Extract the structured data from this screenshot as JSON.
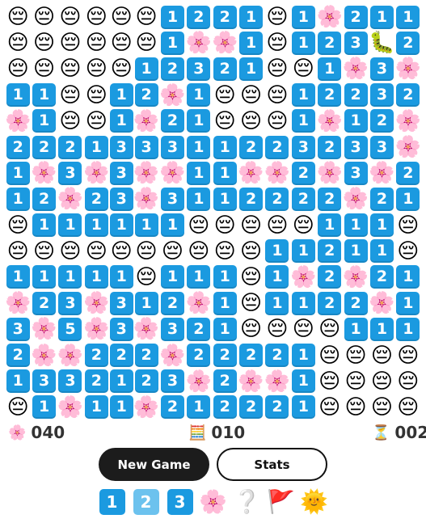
{
  "board": {
    "rows": [
      [
        "😔",
        "😔",
        "😔",
        "😔",
        "😔",
        "😔",
        "1",
        "2",
        "2",
        "1",
        "😔",
        "1",
        "🌸",
        "2",
        "1",
        "1"
      ],
      [
        "😔",
        "😔",
        "😔",
        "😔",
        "😔",
        "😔",
        "1",
        "🌸",
        "🌸",
        "1",
        "😔",
        "1",
        "2",
        "3",
        "🐛",
        "2"
      ],
      [
        "😔",
        "😔",
        "😔",
        "😔",
        "😔",
        "1",
        "2",
        "3",
        "2",
        "1",
        "😔",
        "😔",
        "1",
        "🌸",
        "3",
        "🌸"
      ],
      [
        "1",
        "1",
        "😔",
        "😔",
        "1",
        "2",
        "🌸",
        "1",
        "😔",
        "😔",
        "😔",
        "1",
        "2",
        "2",
        "3",
        "2"
      ],
      [
        "🌸",
        "1",
        "😔",
        "😔",
        "1",
        "🌸",
        "2",
        "1",
        "😔",
        "😔",
        "😔",
        "1",
        "🌸",
        "1",
        "2",
        "🌸"
      ],
      [
        "2",
        "2",
        "2",
        "1",
        "3",
        "3",
        "3",
        "1",
        "1",
        "2",
        "2",
        "3",
        "2",
        "3",
        "3",
        "🌸"
      ],
      [
        "1",
        "🌸",
        "3",
        "🌸",
        "3",
        "🌸",
        "🌸",
        "1",
        "1",
        "🌸",
        "🌸",
        "2",
        "🌸",
        "3",
        "🌸",
        "2"
      ],
      [
        "1",
        "2",
        "🌸",
        "2",
        "3",
        "🌸",
        "3",
        "1",
        "1",
        "2",
        "2",
        "2",
        "2",
        "🌸",
        "2",
        "1"
      ],
      [
        "😔",
        "1",
        "1",
        "1",
        "1",
        "1",
        "1",
        "😔",
        "😔",
        "😔",
        "😔",
        "😔",
        "1",
        "1",
        "1",
        "😔"
      ],
      [
        "😔",
        "😔",
        "😔",
        "😔",
        "😔",
        "😔",
        "😔",
        "😔",
        "😔",
        "😔",
        "1",
        "1",
        "2",
        "1",
        "1",
        "😔"
      ],
      [
        "1",
        "1",
        "1",
        "1",
        "1",
        "😔",
        "1",
        "1",
        "1",
        "😔",
        "1",
        "🌸",
        "2",
        "🌸",
        "2",
        "1"
      ],
      [
        "🌸",
        "2",
        "3",
        "🌸",
        "3",
        "1",
        "2",
        "🌸",
        "1",
        "😔",
        "1",
        "1",
        "2",
        "2",
        "🌸",
        "1"
      ],
      [
        "3",
        "🌸",
        "5",
        "🌸",
        "3",
        "🌸",
        "3",
        "2",
        "1",
        "😔",
        "😔",
        "😔",
        "😔",
        "1",
        "1",
        "1"
      ],
      [
        "2",
        "🌸",
        "🌸",
        "2",
        "2",
        "2",
        "🌸",
        "2",
        "2",
        "2",
        "2",
        "1",
        "😔",
        "😔",
        "😔",
        "😔"
      ],
      [
        "1",
        "3",
        "3",
        "2",
        "1",
        "2",
        "3",
        "🌸",
        "2",
        "🌸",
        "🌸",
        "1",
        "😔",
        "😔",
        "😔",
        "😔"
      ],
      [
        "😔",
        "1",
        "🌸",
        "1",
        "1",
        "🌸",
        "2",
        "1",
        "2",
        "2",
        "2",
        "1",
        "😔",
        "😔",
        "😔",
        "😔"
      ]
    ]
  },
  "status": {
    "flowers": {
      "icon": "🌸",
      "icon_name": "flower-icon",
      "value": "040"
    },
    "abacus": {
      "icon": "🧮",
      "icon_name": "abacus-icon",
      "value": "010"
    },
    "timer": {
      "icon": "⏳",
      "icon_name": "hourglass-icon",
      "value": "002"
    }
  },
  "controls": {
    "new_game_label": "New Game",
    "stats_label": "Stats"
  },
  "palette": [
    {
      "kind": "tile",
      "label": "1",
      "name": "tile-1-swatch"
    },
    {
      "kind": "tile-light",
      "label": "2",
      "name": "tile-2-swatch"
    },
    {
      "kind": "tile",
      "label": "3",
      "name": "tile-3-swatch"
    },
    {
      "kind": "emoji",
      "label": "🌸",
      "name": "flower-icon"
    },
    {
      "kind": "emoji",
      "label": "❔",
      "name": "question-icon"
    },
    {
      "kind": "emoji",
      "label": "🚩",
      "name": "flag-icon"
    },
    {
      "kind": "emoji",
      "label": "🌞",
      "name": "sun-face-icon"
    }
  ],
  "colors": {
    "tile": "#1b9ae0",
    "tile_light": "#6cc2ee",
    "button_dark": "#1c1c1c"
  }
}
